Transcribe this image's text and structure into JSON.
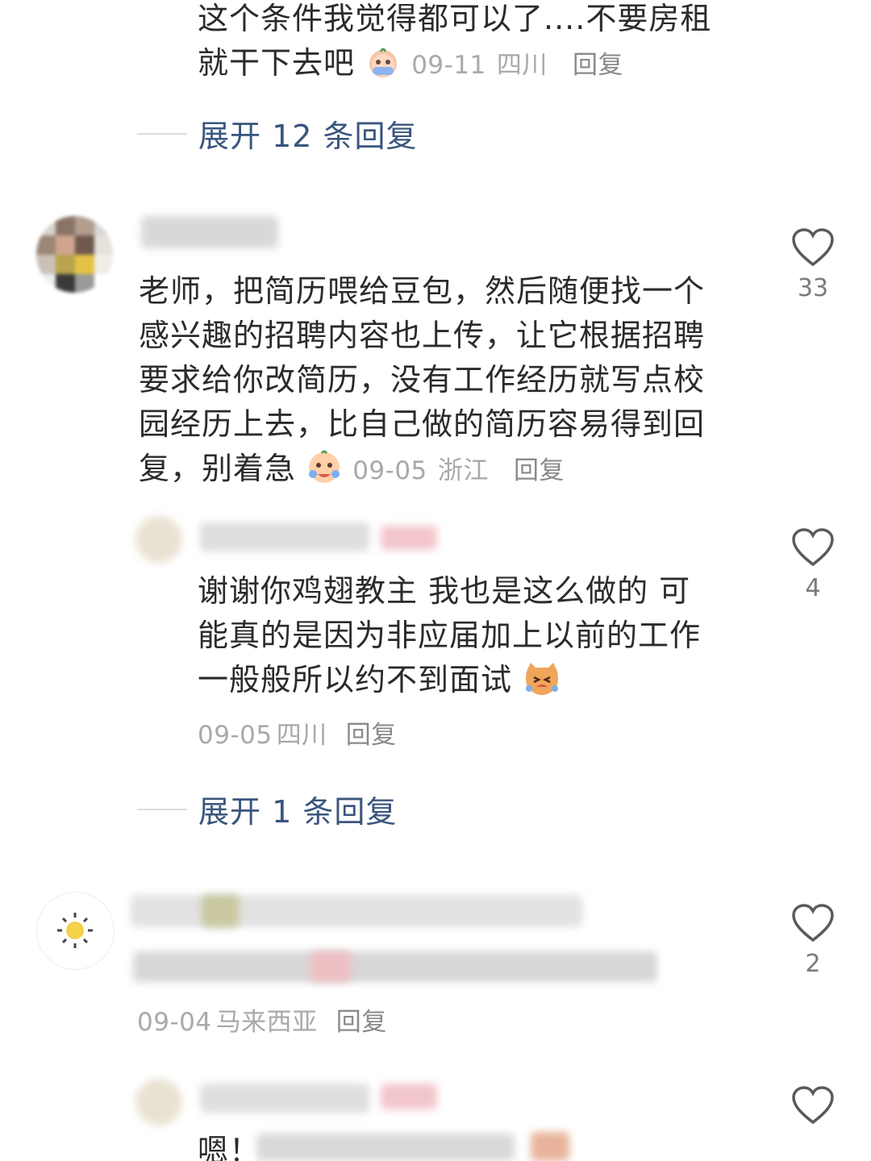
{
  "comments": {
    "top_reply": {
      "text_line1": "这个条件我觉得都可以了....不要房租",
      "text_line2": "就干下去吧",
      "emoji": "crying-face-icon",
      "date": "09-11",
      "location": "四川",
      "reply_label": "回复",
      "expand_label": "展开 12 条回复"
    },
    "main_comment": {
      "text": "老师，把简历喂给豆包，然后随便找一个感兴趣的招聘内容也上传，让它根据招聘要求给你改简历，没有工作经历就写点校园经历上去，比自己做的简历容易得到回复，别着急",
      "line1": "老师，把简历喂给豆包，然后随便找一个",
      "line2": "感兴趣的招聘内容也上传，让它根据招聘",
      "line3": "要求给你改简历，没有工作经历就写点校",
      "line4": "园经历上去，比自己做的简历容易得到回",
      "line5": "复，别着急",
      "emoji": "crying-face-icon",
      "date": "09-05",
      "location": "浙江",
      "reply_label": "回复",
      "likes": "33"
    },
    "sub_reply": {
      "line1": "谢谢你鸡翅教主 我也是这么做的 可",
      "line2": "能真的是因为非应届加上以前的工作",
      "line3": "一般般所以约不到面试",
      "emoji": "crying-cat-icon",
      "date": "09-05",
      "location": "四川",
      "reply_label": "回复",
      "likes": "4",
      "expand_label": "展开 1 条回复"
    },
    "third_comment": {
      "date": "09-04",
      "location": "马来西亚",
      "reply_label": "回复",
      "likes": "2"
    },
    "fourth_comment": {
      "text_start": "嗯！"
    }
  },
  "colors": {
    "expand_link": "#3a557e",
    "meta_gray": "#a9a9a9",
    "body_text": "#2b2b2b"
  }
}
